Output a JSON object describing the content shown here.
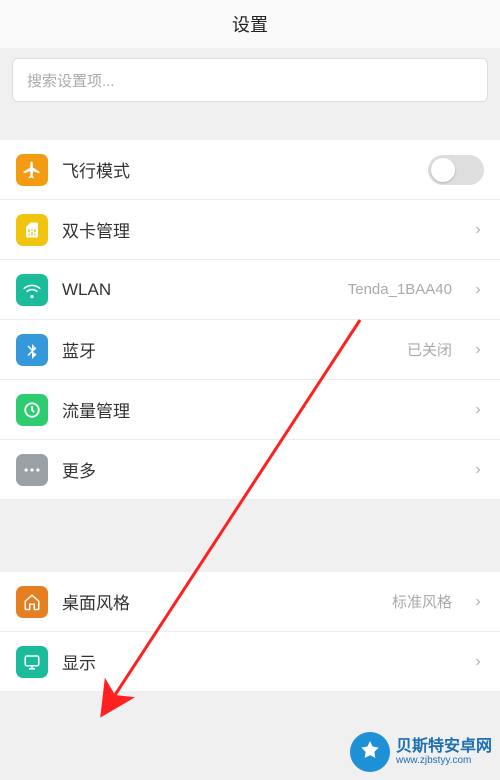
{
  "header": {
    "title": "设置"
  },
  "search": {
    "placeholder": "搜索设置项..."
  },
  "group1": {
    "airplane": {
      "label": "飞行模式",
      "icon_color": "#f39c12"
    },
    "dualsim": {
      "label": "双卡管理",
      "icon_color": "#f1c40f"
    },
    "wlan": {
      "label": "WLAN",
      "value": "Tenda_1BAA40",
      "icon_color": "#1abc9c"
    },
    "bluetooth": {
      "label": "蓝牙",
      "value": "已关闭",
      "icon_color": "#3498db"
    },
    "traffic": {
      "label": "流量管理",
      "icon_color": "#2ecc71"
    },
    "more": {
      "label": "更多",
      "icon_color": "#9aa0a6"
    }
  },
  "group2": {
    "desktop": {
      "label": "桌面风格",
      "value": "标准风格",
      "icon_color": "#e67e22"
    },
    "display": {
      "label": "显示",
      "icon_color": "#1abc9c"
    }
  },
  "watermark": {
    "line1": "贝斯特安卓网",
    "line2": "www.zjbstyy.com"
  }
}
